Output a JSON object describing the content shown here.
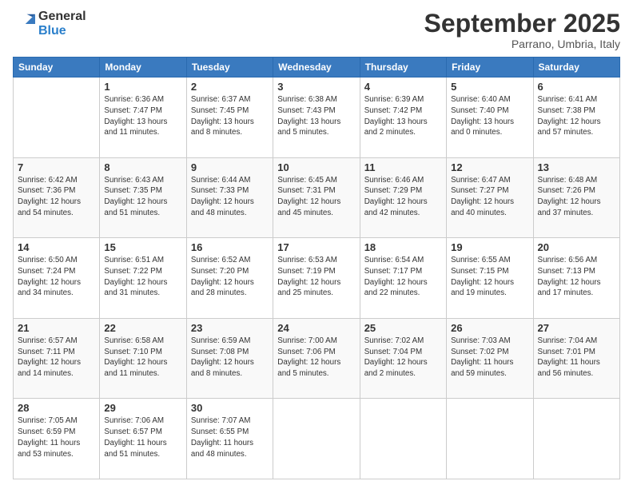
{
  "logo": {
    "general": "General",
    "blue": "Blue"
  },
  "header": {
    "month": "September 2025",
    "location": "Parrano, Umbria, Italy"
  },
  "days_of_week": [
    "Sunday",
    "Monday",
    "Tuesday",
    "Wednesday",
    "Thursday",
    "Friday",
    "Saturday"
  ],
  "weeks": [
    [
      {
        "day": "",
        "info": ""
      },
      {
        "day": "1",
        "info": "Sunrise: 6:36 AM\nSunset: 7:47 PM\nDaylight: 13 hours\nand 11 minutes."
      },
      {
        "day": "2",
        "info": "Sunrise: 6:37 AM\nSunset: 7:45 PM\nDaylight: 13 hours\nand 8 minutes."
      },
      {
        "day": "3",
        "info": "Sunrise: 6:38 AM\nSunset: 7:43 PM\nDaylight: 13 hours\nand 5 minutes."
      },
      {
        "day": "4",
        "info": "Sunrise: 6:39 AM\nSunset: 7:42 PM\nDaylight: 13 hours\nand 2 minutes."
      },
      {
        "day": "5",
        "info": "Sunrise: 6:40 AM\nSunset: 7:40 PM\nDaylight: 13 hours\nand 0 minutes."
      },
      {
        "day": "6",
        "info": "Sunrise: 6:41 AM\nSunset: 7:38 PM\nDaylight: 12 hours\nand 57 minutes."
      }
    ],
    [
      {
        "day": "7",
        "info": "Sunrise: 6:42 AM\nSunset: 7:36 PM\nDaylight: 12 hours\nand 54 minutes."
      },
      {
        "day": "8",
        "info": "Sunrise: 6:43 AM\nSunset: 7:35 PM\nDaylight: 12 hours\nand 51 minutes."
      },
      {
        "day": "9",
        "info": "Sunrise: 6:44 AM\nSunset: 7:33 PM\nDaylight: 12 hours\nand 48 minutes."
      },
      {
        "day": "10",
        "info": "Sunrise: 6:45 AM\nSunset: 7:31 PM\nDaylight: 12 hours\nand 45 minutes."
      },
      {
        "day": "11",
        "info": "Sunrise: 6:46 AM\nSunset: 7:29 PM\nDaylight: 12 hours\nand 42 minutes."
      },
      {
        "day": "12",
        "info": "Sunrise: 6:47 AM\nSunset: 7:27 PM\nDaylight: 12 hours\nand 40 minutes."
      },
      {
        "day": "13",
        "info": "Sunrise: 6:48 AM\nSunset: 7:26 PM\nDaylight: 12 hours\nand 37 minutes."
      }
    ],
    [
      {
        "day": "14",
        "info": "Sunrise: 6:50 AM\nSunset: 7:24 PM\nDaylight: 12 hours\nand 34 minutes."
      },
      {
        "day": "15",
        "info": "Sunrise: 6:51 AM\nSunset: 7:22 PM\nDaylight: 12 hours\nand 31 minutes."
      },
      {
        "day": "16",
        "info": "Sunrise: 6:52 AM\nSunset: 7:20 PM\nDaylight: 12 hours\nand 28 minutes."
      },
      {
        "day": "17",
        "info": "Sunrise: 6:53 AM\nSunset: 7:19 PM\nDaylight: 12 hours\nand 25 minutes."
      },
      {
        "day": "18",
        "info": "Sunrise: 6:54 AM\nSunset: 7:17 PM\nDaylight: 12 hours\nand 22 minutes."
      },
      {
        "day": "19",
        "info": "Sunrise: 6:55 AM\nSunset: 7:15 PM\nDaylight: 12 hours\nand 19 minutes."
      },
      {
        "day": "20",
        "info": "Sunrise: 6:56 AM\nSunset: 7:13 PM\nDaylight: 12 hours\nand 17 minutes."
      }
    ],
    [
      {
        "day": "21",
        "info": "Sunrise: 6:57 AM\nSunset: 7:11 PM\nDaylight: 12 hours\nand 14 minutes."
      },
      {
        "day": "22",
        "info": "Sunrise: 6:58 AM\nSunset: 7:10 PM\nDaylight: 12 hours\nand 11 minutes."
      },
      {
        "day": "23",
        "info": "Sunrise: 6:59 AM\nSunset: 7:08 PM\nDaylight: 12 hours\nand 8 minutes."
      },
      {
        "day": "24",
        "info": "Sunrise: 7:00 AM\nSunset: 7:06 PM\nDaylight: 12 hours\nand 5 minutes."
      },
      {
        "day": "25",
        "info": "Sunrise: 7:02 AM\nSunset: 7:04 PM\nDaylight: 12 hours\nand 2 minutes."
      },
      {
        "day": "26",
        "info": "Sunrise: 7:03 AM\nSunset: 7:02 PM\nDaylight: 11 hours\nand 59 minutes."
      },
      {
        "day": "27",
        "info": "Sunrise: 7:04 AM\nSunset: 7:01 PM\nDaylight: 11 hours\nand 56 minutes."
      }
    ],
    [
      {
        "day": "28",
        "info": "Sunrise: 7:05 AM\nSunset: 6:59 PM\nDaylight: 11 hours\nand 53 minutes."
      },
      {
        "day": "29",
        "info": "Sunrise: 7:06 AM\nSunset: 6:57 PM\nDaylight: 11 hours\nand 51 minutes."
      },
      {
        "day": "30",
        "info": "Sunrise: 7:07 AM\nSunset: 6:55 PM\nDaylight: 11 hours\nand 48 minutes."
      },
      {
        "day": "",
        "info": ""
      },
      {
        "day": "",
        "info": ""
      },
      {
        "day": "",
        "info": ""
      },
      {
        "day": "",
        "info": ""
      }
    ]
  ]
}
